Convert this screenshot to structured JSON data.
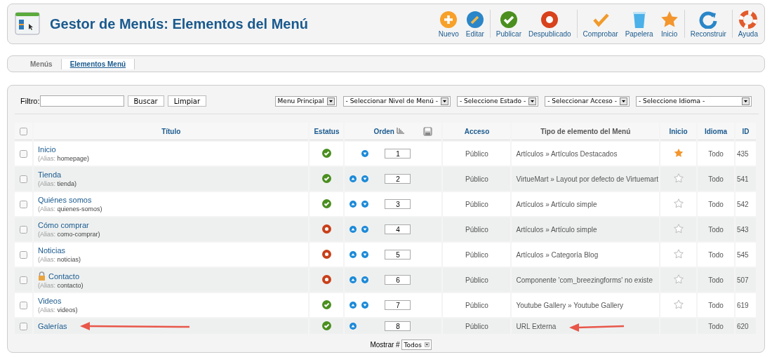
{
  "header": {
    "title": "Gestor de Menús: Elementos del Menú"
  },
  "toolbar": [
    {
      "label": "Nuevo",
      "kind": "new",
      "group_start": false
    },
    {
      "label": "Editar",
      "kind": "edit",
      "group_start": false
    },
    {
      "label": "Publicar",
      "kind": "publish",
      "group_start": true
    },
    {
      "label": "Despublicado",
      "kind": "unpublish",
      "group_start": false
    },
    {
      "label": "Comprobar",
      "kind": "check",
      "group_start": true
    },
    {
      "label": "Papelera",
      "kind": "trash",
      "group_start": false
    },
    {
      "label": "Inicio",
      "kind": "home",
      "group_start": false
    },
    {
      "label": "Reconstruir",
      "kind": "rebuild",
      "group_start": true
    },
    {
      "label": "Ayuda",
      "kind": "help",
      "group_start": true
    }
  ],
  "submenu": [
    {
      "label": "Menús",
      "selected": false
    },
    {
      "label": "Elementos Menú",
      "selected": true
    }
  ],
  "filter": {
    "label": "Filtro:",
    "search_button": "Buscar",
    "clear_button": "Limpiar",
    "selects": [
      {
        "value": "Menu Principal",
        "wide": false
      },
      {
        "value": "- Seleccionar Nivel de Menú -",
        "wide": false
      },
      {
        "value": "- Seleccione Estado -",
        "wide": false
      },
      {
        "value": "- Seleccionar Acceso -",
        "wide": false
      },
      {
        "value": "- Seleccione Idioma -",
        "wide": true
      }
    ]
  },
  "table": {
    "select_all_checked": false,
    "columns": [
      {
        "label": "Título",
        "kind": "link"
      },
      {
        "label": "Estatus",
        "kind": "link"
      },
      {
        "label": "Orden",
        "kind": "order"
      },
      {
        "label": "Acceso",
        "kind": "link"
      },
      {
        "label": "Tipo de elemento del Menú",
        "kind": "plain"
      },
      {
        "label": "Inicio",
        "kind": "link"
      },
      {
        "label": "Idioma",
        "kind": "link"
      },
      {
        "label": "ID",
        "kind": "link"
      }
    ],
    "rows": [
      {
        "title": "Inicio",
        "alias": {
          "label": "(Alias:",
          "value": "homepage)"
        },
        "locked": false,
        "published": true,
        "move_up": false,
        "move_down": true,
        "order": "1",
        "access": "Público",
        "type": "Artículos » Artículos Destacados",
        "home": true,
        "checked": false,
        "language": "Todo",
        "id": "435",
        "marked": false
      },
      {
        "title": "Tienda",
        "alias": {
          "label": "(Alias:",
          "value": "tienda)"
        },
        "locked": false,
        "published": true,
        "move_up": true,
        "move_down": true,
        "order": "2",
        "access": "Público",
        "type": "VirtueMart » Layout por defecto de Virtuemart",
        "home": false,
        "checked": false,
        "language": "Todo",
        "id": "541",
        "marked": false
      },
      {
        "title": "Quiénes somos",
        "alias": {
          "label": "(Alias:",
          "value": "quienes-somos)"
        },
        "locked": false,
        "published": true,
        "move_up": true,
        "move_down": true,
        "order": "3",
        "access": "Público",
        "type": "Artículos » Artículo simple",
        "home": false,
        "checked": false,
        "language": "Todo",
        "id": "542",
        "marked": false
      },
      {
        "title": "Cómo comprar",
        "alias": {
          "label": "(Alias:",
          "value": "como-comprar)"
        },
        "locked": false,
        "published": false,
        "move_up": true,
        "move_down": true,
        "order": "4",
        "access": "Público",
        "type": "Artículos » Artículo simple",
        "home": false,
        "checked": false,
        "language": "Todo",
        "id": "543",
        "marked": false
      },
      {
        "title": "Noticias",
        "alias": {
          "label": "(Alias:",
          "value": "noticias)"
        },
        "locked": false,
        "published": false,
        "move_up": true,
        "move_down": true,
        "order": "5",
        "access": "Público",
        "type": "Artículos » Categoría Blog",
        "home": false,
        "checked": false,
        "language": "Todo",
        "id": "545",
        "marked": false
      },
      {
        "title": "Contacto",
        "alias": {
          "label": "(Alias:",
          "value": "contacto)"
        },
        "locked": true,
        "published": false,
        "move_up": true,
        "move_down": true,
        "order": "6",
        "access": "Público",
        "type": "Componente 'com_breezingforms' no existe",
        "home": false,
        "checked": false,
        "language": "Todo",
        "id": "507",
        "marked": false
      },
      {
        "title": "Videos",
        "alias": {
          "label": "(Alias:",
          "value": "videos)"
        },
        "locked": false,
        "published": true,
        "move_up": true,
        "move_down": true,
        "order": "7",
        "access": "Público",
        "type": "Youtube Gallery » Youtube Gallery",
        "home": false,
        "checked": false,
        "language": "Todo",
        "id": "619",
        "marked": false
      },
      {
        "title": "Galerías",
        "locked": false,
        "published": true,
        "move_up": true,
        "move_down": false,
        "order": "8",
        "access": "Público",
        "type": "URL Externa",
        "checked": false,
        "language": "Todo",
        "id": "620",
        "marked": true
      }
    ]
  },
  "footer": {
    "label": "Mostrar #",
    "limit": "Todos"
  }
}
